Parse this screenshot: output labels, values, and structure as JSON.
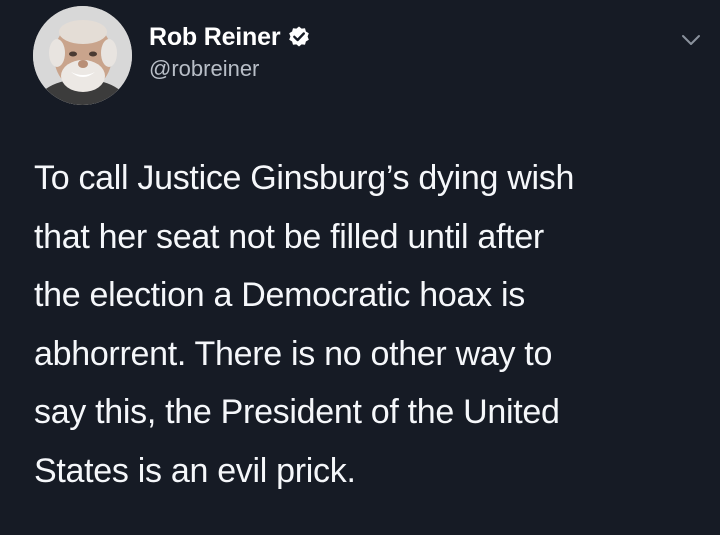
{
  "author": {
    "display_name": "Rob Reiner",
    "handle": "@robreiner",
    "verified": true,
    "avatar_icon": "user-avatar-photo"
  },
  "tweet": {
    "lines": [
      "To call Justice Ginsburg’s dying wish",
      "that her seat not be filled until after",
      "the election a Democratic hoax is",
      "abhorrent. There is no other way to",
      "say this, the President of the United",
      "States is an evil prick."
    ]
  },
  "icons": {
    "verified": "verified-badge-icon",
    "menu": "chevron-down-icon"
  },
  "colors": {
    "background": "#161b25",
    "text": "#f5f7fa",
    "secondary_text": "#b8bec7"
  }
}
